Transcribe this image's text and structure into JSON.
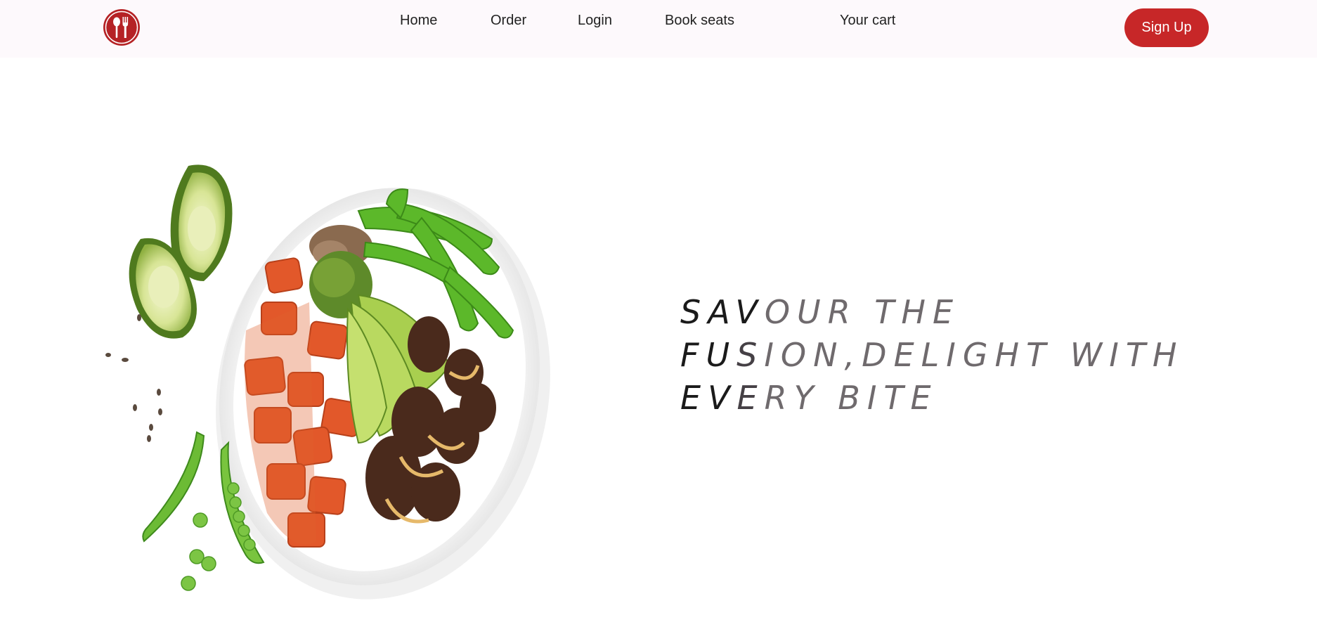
{
  "nav": {
    "logo": "fork-spoon-logo-icon",
    "links": [
      "Home",
      "Order",
      "Login",
      "Book seats",
      "Your cart"
    ],
    "signup_label": "Sign Up"
  },
  "hero": {
    "image": "food-bowl-illustration",
    "headline": {
      "line1_dark": "SAV",
      "line1_rest": "OUR THE",
      "line2_dark": "FU",
      "line2_mid": "S",
      "line2_rest": "ION,DELIGHT WITH",
      "line3_dark": "EV",
      "line3_mid": "E",
      "line3_rest": "RY BITE"
    }
  },
  "colors": {
    "accent": "#c72728",
    "nav_bg": "#fdf9fc",
    "text_light": "#6f6a6d"
  }
}
